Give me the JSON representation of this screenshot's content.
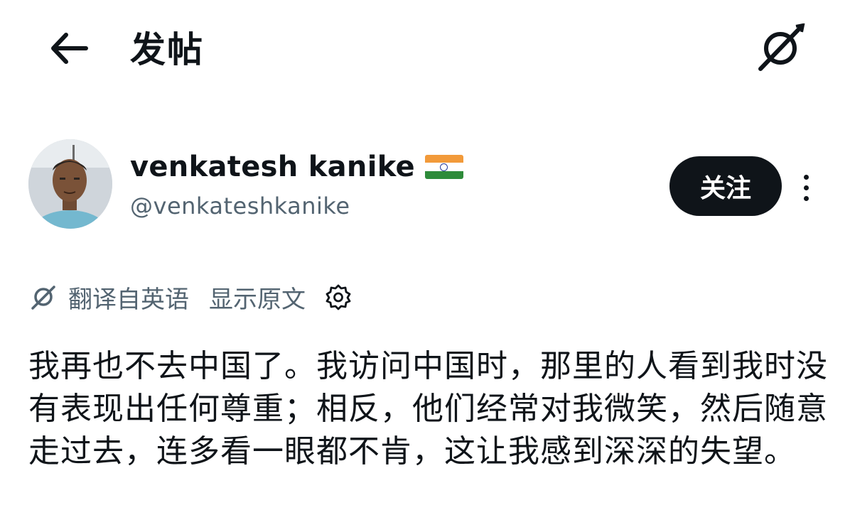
{
  "header": {
    "back_icon": "arrow-left-icon",
    "title": "发帖",
    "grok_icon": "grok-icon"
  },
  "author": {
    "display_name": "venkatesh kanike",
    "flag_emoji": "india-flag",
    "handle": "@venkateshkanike",
    "follow_label": "关注",
    "more_icon": "more-vertical-icon"
  },
  "translation": {
    "label": "翻译自英语",
    "show_original": "显示原文",
    "settings_icon": "gear-icon"
  },
  "post": {
    "text": "我再也不去中国了。我访问中国时，那里的人看到我时没有表现出任何尊重；相反，他们经常对我微笑，然后随意走过去，连多看一眼都不肯，这让我感到深深的失望。"
  },
  "colors": {
    "text_primary": "#0f1419",
    "text_secondary": "#536471",
    "follow_bg": "#0f1419",
    "follow_text": "#ffffff",
    "flag_saffron": "#f29a3a",
    "flag_white": "#ffffff",
    "flag_green": "#2e8b3a"
  }
}
